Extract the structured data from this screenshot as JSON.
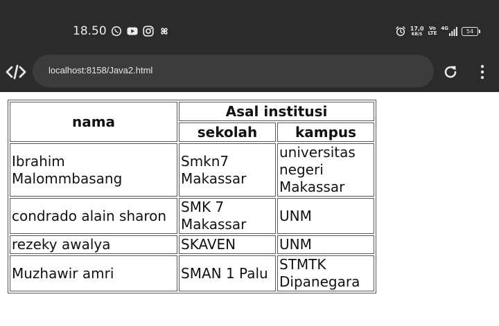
{
  "status_bar": {
    "time": "18.50",
    "net_speed_value": "17,0",
    "net_speed_unit": "KB/S",
    "volte_top": "Vo",
    "volte_bottom": "LTE",
    "network_type": "4G",
    "battery_level": "54",
    "app_icons": [
      "whatsapp-icon",
      "youtube-icon",
      "instagram-icon",
      "pinwheel-app-icon"
    ]
  },
  "browser": {
    "url": "localhost:8158/Java2.html"
  },
  "table": {
    "headers": {
      "name": "nama",
      "group": "Asal institusi",
      "school": "sekolah",
      "campus": "kampus"
    },
    "rows": [
      {
        "name": "Ibrahim Malommbasang",
        "school": "Smkn7 Makassar",
        "campus": "universitas negeri Makassar"
      },
      {
        "name": "condrado alain sharon",
        "school": "SMK 7 Makassar",
        "campus": "UNM"
      },
      {
        "name": "rezeky awalya",
        "school": "SKAVEN",
        "campus": "UNM"
      },
      {
        "name": "Muzhawir amri",
        "school": "SMAN 1 Palu",
        "campus": "STMTK Dipanegara"
      }
    ]
  }
}
